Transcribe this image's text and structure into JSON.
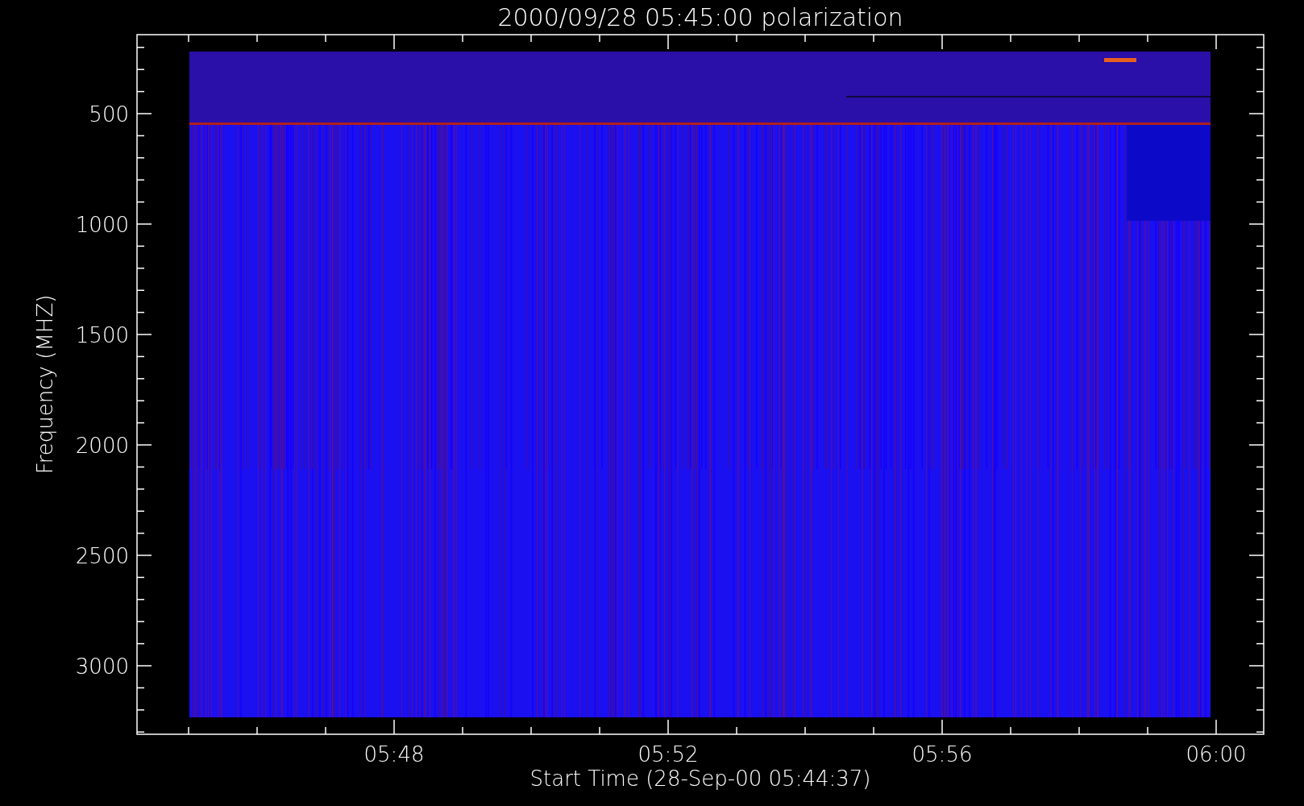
{
  "plot": {
    "title": "2000/09/28 05:45:00 polarization",
    "xlabel": "Start Time (28-Sep-00 05:44:37)",
    "ylabel": "Frequency (MHZ)",
    "x_tick_labels": [
      "05:48",
      "05:52",
      "05:56",
      "06:00"
    ],
    "y_tick_labels": [
      "500",
      "1000",
      "1500",
      "2000",
      "2500",
      "3000"
    ]
  }
}
